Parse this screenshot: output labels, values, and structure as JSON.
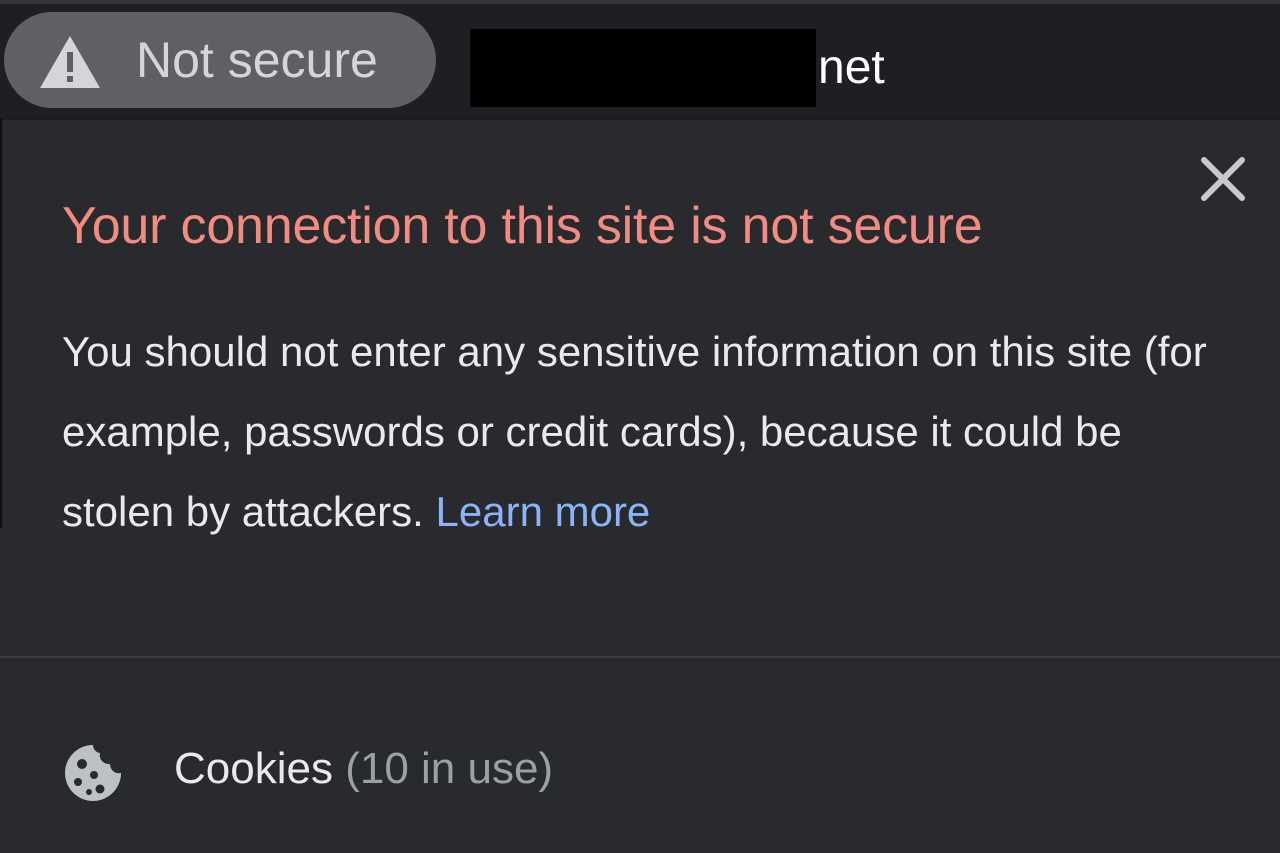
{
  "address_bar": {
    "security_label": "Not secure",
    "security_icon": "warning-triangle-icon",
    "url_visible_suffix": "net",
    "redaction_color": "#000000"
  },
  "popup": {
    "title": "Your connection to this site is not secure",
    "body": "You should not enter any sensitive information on this site (for example, passwords or credit cards), because it could be stolen by attackers.",
    "learn_more": "Learn more",
    "close_icon": "close-icon",
    "cookies": {
      "label": "Cookies",
      "count": "(10 in use)",
      "icon": "cookie-icon"
    }
  },
  "colors": {
    "title_red": "#f28b82",
    "link_blue": "#8ab4f8",
    "background": "#292a2d",
    "text": "#e8eaed"
  }
}
